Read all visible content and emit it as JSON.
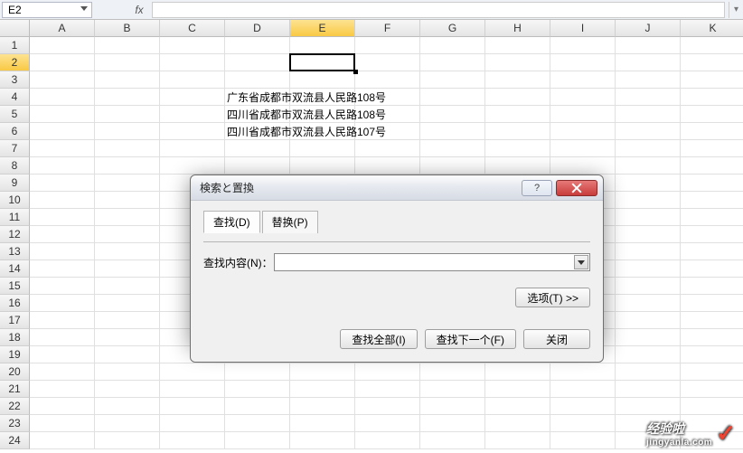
{
  "namebox": {
    "value": "E2"
  },
  "formula_bar": {
    "fx_label": "fx",
    "value": ""
  },
  "columns": [
    "A",
    "B",
    "C",
    "D",
    "E",
    "F",
    "G",
    "H",
    "I",
    "J",
    "K"
  ],
  "active_col_index": 4,
  "rows": [
    1,
    2,
    3,
    4,
    5,
    6,
    7,
    8,
    9,
    10,
    11,
    12,
    13,
    14,
    15,
    16,
    17,
    18,
    19,
    20,
    21,
    22,
    23,
    24
  ],
  "active_row_index": 1,
  "cells": {
    "D4": "广东省成都市双流县人民路108号",
    "D5": "四川省成都市双流县人民路108号",
    "D6": "四川省成都市双流县人民路107号"
  },
  "dialog": {
    "title": "検索と置換",
    "help_label": "?",
    "close_label": "✕",
    "tabs": {
      "find": "查找(D)",
      "replace": "替换(P)"
    },
    "find_label": "查找内容(N)：",
    "find_value": "",
    "options_btn": "选项(T) >>",
    "find_all_btn": "查找全部(I)",
    "find_next_btn": "查找下一个(F)",
    "close_btn": "关闭"
  },
  "watermark": {
    "brand": "经验啦",
    "url": "jingyanla.com"
  }
}
